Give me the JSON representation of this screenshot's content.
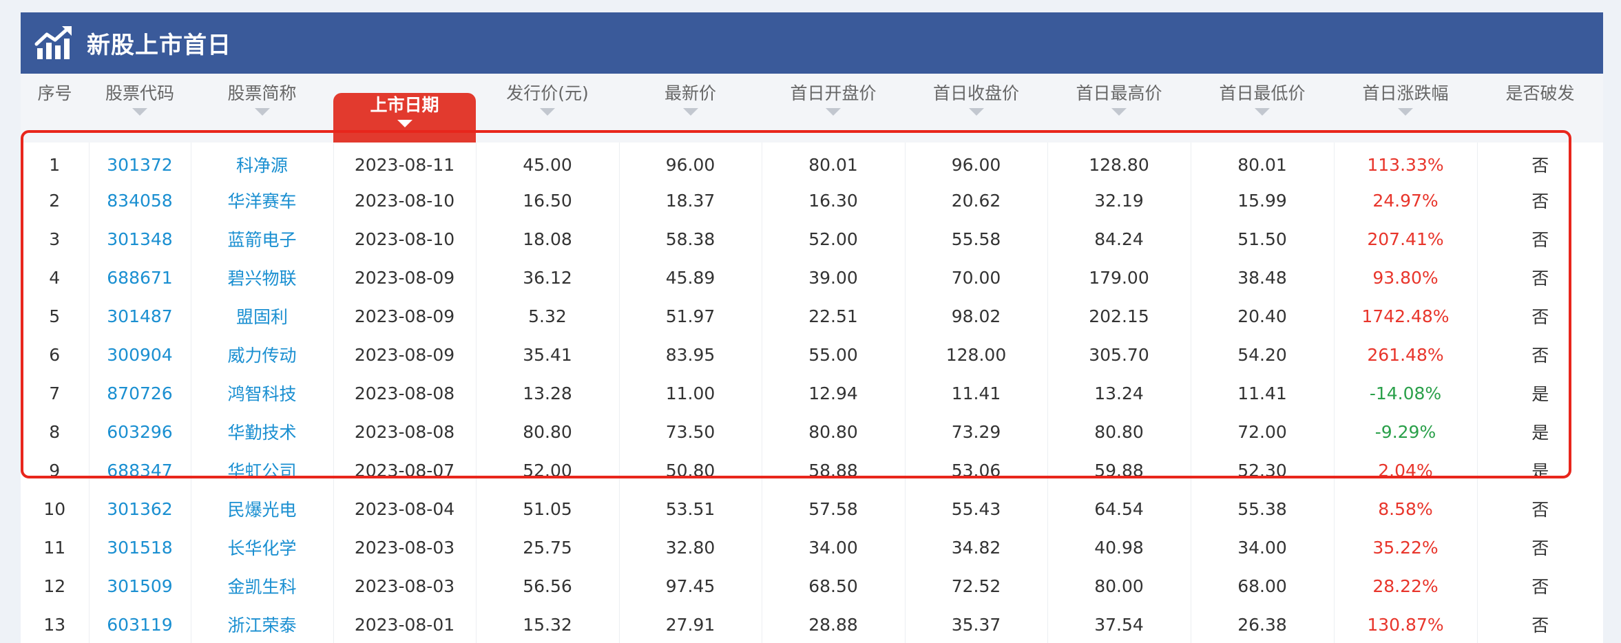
{
  "header": {
    "title": "新股上市首日",
    "icon": "chart-trend-icon"
  },
  "columns": [
    "序号",
    "股票代码",
    "股票简称",
    "上市日期",
    "发行价(元)",
    "最新价",
    "首日开盘价",
    "首日收盘价",
    "首日最高价",
    "首日最低价",
    "首日涨跌幅",
    "是否破发"
  ],
  "active_sort_column": "上市日期",
  "colors": {
    "title_bar": "#3a5a9a",
    "active_header": "#e23a2e",
    "link": "#1a8fd1",
    "rise": "#e8352b",
    "fall": "#2aa04a",
    "highlight_border": "#e8261c"
  },
  "rows": [
    {
      "no": "1",
      "code": "301372",
      "name": "科净源",
      "date": "2023-08-11",
      "issue": "45.00",
      "latest": "96.00",
      "open": "80.01",
      "close": "96.00",
      "high": "128.80",
      "low": "80.01",
      "change": "113.33%",
      "dir": "up",
      "broken": "否"
    },
    {
      "no": "2",
      "code": "834058",
      "name": "华洋赛车",
      "date": "2023-08-10",
      "issue": "16.50",
      "latest": "18.37",
      "open": "16.30",
      "close": "20.62",
      "high": "32.19",
      "low": "15.99",
      "change": "24.97%",
      "dir": "up",
      "broken": "否"
    },
    {
      "no": "3",
      "code": "301348",
      "name": "蓝箭电子",
      "date": "2023-08-10",
      "issue": "18.08",
      "latest": "58.38",
      "open": "52.00",
      "close": "55.58",
      "high": "84.24",
      "low": "51.50",
      "change": "207.41%",
      "dir": "up",
      "broken": "否"
    },
    {
      "no": "4",
      "code": "688671",
      "name": "碧兴物联",
      "date": "2023-08-09",
      "issue": "36.12",
      "latest": "45.89",
      "open": "39.00",
      "close": "70.00",
      "high": "179.00",
      "low": "38.48",
      "change": "93.80%",
      "dir": "up",
      "broken": "否"
    },
    {
      "no": "5",
      "code": "301487",
      "name": "盟固利",
      "date": "2023-08-09",
      "issue": "5.32",
      "latest": "51.97",
      "open": "22.51",
      "close": "98.02",
      "high": "202.15",
      "low": "20.40",
      "change": "1742.48%",
      "dir": "up",
      "broken": "否"
    },
    {
      "no": "6",
      "code": "300904",
      "name": "威力传动",
      "date": "2023-08-09",
      "issue": "35.41",
      "latest": "83.95",
      "open": "55.00",
      "close": "128.00",
      "high": "305.70",
      "low": "54.20",
      "change": "261.48%",
      "dir": "up",
      "broken": "否"
    },
    {
      "no": "7",
      "code": "870726",
      "name": "鸿智科技",
      "date": "2023-08-08",
      "issue": "13.28",
      "latest": "11.00",
      "open": "12.94",
      "close": "11.41",
      "high": "13.24",
      "low": "11.41",
      "change": "-14.08%",
      "dir": "down",
      "broken": "是"
    },
    {
      "no": "8",
      "code": "603296",
      "name": "华勤技术",
      "date": "2023-08-08",
      "issue": "80.80",
      "latest": "73.50",
      "open": "80.80",
      "close": "73.29",
      "high": "80.80",
      "low": "72.00",
      "change": "-9.29%",
      "dir": "down",
      "broken": "是"
    },
    {
      "no": "9",
      "code": "688347",
      "name": "华虹公司",
      "date": "2023-08-07",
      "issue": "52.00",
      "latest": "50.80",
      "open": "58.88",
      "close": "53.06",
      "high": "59.88",
      "low": "52.30",
      "change": "2.04%",
      "dir": "up",
      "broken": "是"
    },
    {
      "no": "10",
      "code": "301362",
      "name": "民爆光电",
      "date": "2023-08-04",
      "issue": "51.05",
      "latest": "53.51",
      "open": "57.58",
      "close": "55.43",
      "high": "64.54",
      "low": "55.38",
      "change": "8.58%",
      "dir": "up",
      "broken": "否"
    },
    {
      "no": "11",
      "code": "301518",
      "name": "长华化学",
      "date": "2023-08-03",
      "issue": "25.75",
      "latest": "32.80",
      "open": "34.00",
      "close": "34.82",
      "high": "40.98",
      "low": "34.00",
      "change": "35.22%",
      "dir": "up",
      "broken": "否"
    },
    {
      "no": "12",
      "code": "301509",
      "name": "金凯生科",
      "date": "2023-08-03",
      "issue": "56.56",
      "latest": "97.45",
      "open": "68.50",
      "close": "72.52",
      "high": "80.00",
      "low": "68.00",
      "change": "28.22%",
      "dir": "up",
      "broken": "否"
    },
    {
      "no": "13",
      "code": "603119",
      "name": "浙江荣泰",
      "date": "2023-08-01",
      "issue": "15.32",
      "latest": "27.91",
      "open": "28.88",
      "close": "35.37",
      "high": "37.54",
      "low": "26.38",
      "change": "130.87%",
      "dir": "up",
      "broken": "否"
    }
  ]
}
